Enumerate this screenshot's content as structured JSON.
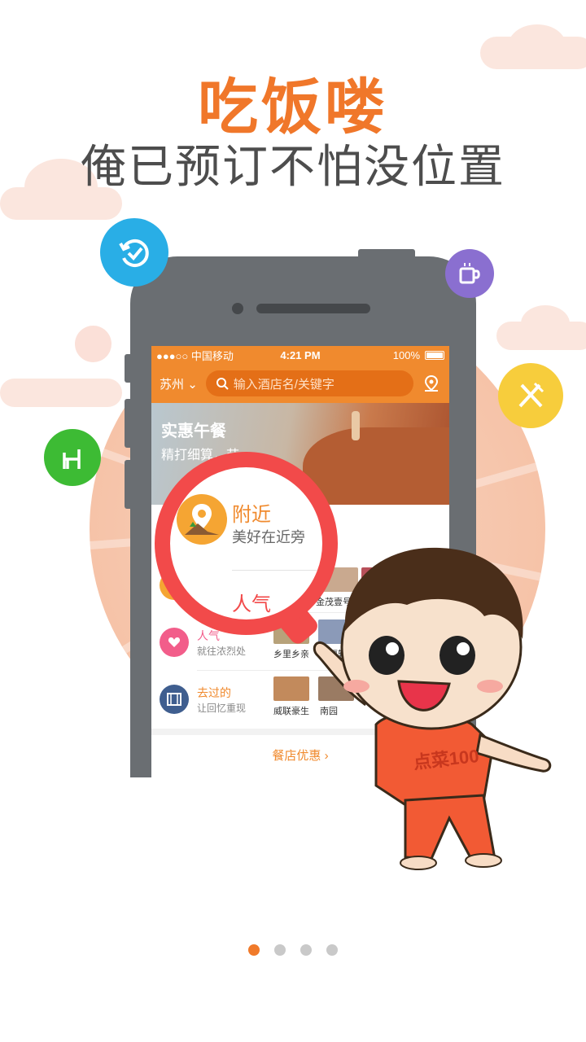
{
  "headline": {
    "title": "吃饭喽",
    "subtitle": "俺已预订不怕没位置"
  },
  "colors": {
    "accent": "#f08a2e",
    "title": "#f0772a",
    "magnifier": "#f24a4a",
    "dot_active": "#f07a2a",
    "dot_inactive": "#c9c9c9"
  },
  "badges": {
    "top_left": {
      "icon": "history-check-icon",
      "color": "#29aee6"
    },
    "top_right": {
      "icon": "coffee-cup-icon",
      "color": "#8a6fd0"
    },
    "left": {
      "icon": "chair-icon",
      "color": "#3dbb34"
    },
    "right": {
      "icon": "fork-knife-icon",
      "color": "#f7cd3c"
    }
  },
  "phone": {
    "status": {
      "carrier": "●●●○○ 中国移动",
      "time": "4:21 PM",
      "battery": "100%"
    },
    "appbar": {
      "city": "苏州",
      "search_placeholder": "输入酒店名/关键字"
    },
    "banner": {
      "title": "实惠午餐",
      "subtitle": "精打细算，节"
    },
    "rows": [
      {
        "title": "附近",
        "subtitle": "美好在近旁",
        "thumbs": [
          "",
          "金茂壹号"
        ]
      },
      {
        "title": "人气",
        "subtitle": "就往浓烈处",
        "thumbs": [
          "乡里乡亲",
          "莫厘轩"
        ]
      },
      {
        "title": "去过的",
        "subtitle": "让回忆重现",
        "thumbs": [
          "威联豪生",
          "南园"
        ]
      }
    ],
    "promo": "餐店优惠"
  },
  "magnifier": {
    "title": "附近",
    "subtitle": "美好在近旁",
    "next_title": "人气"
  },
  "character": {
    "shirt_text": "点菜100"
  },
  "pager": {
    "count": 4,
    "active": 0
  }
}
